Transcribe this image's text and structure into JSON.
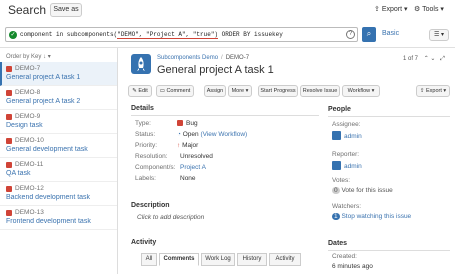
{
  "header": {
    "title": "Search",
    "save_as": "Save as",
    "export": "Export",
    "tools": "Tools"
  },
  "search": {
    "query_prefix": "component in subcomponents(",
    "query_args": "\"DEMO\", \"Project A\", \"true\")",
    "query_suffix": " ORDER BY issuekey",
    "search_icon": "search-icon",
    "basic_label": "Basic",
    "help_label": "?"
  },
  "sidebar": {
    "order_by": "Order by Key",
    "items": [
      {
        "key": "DEMO-7",
        "summary": "General project A task 1",
        "selected": true
      },
      {
        "key": "DEMO-8",
        "summary": "General project A task 2"
      },
      {
        "key": "DEMO-9",
        "summary": "Design task"
      },
      {
        "key": "DEMO-10",
        "summary": "General development task"
      },
      {
        "key": "DEMO-11",
        "summary": "QA task"
      },
      {
        "key": "DEMO-12",
        "summary": "Backend development task"
      },
      {
        "key": "DEMO-13",
        "summary": "Frontend development task"
      }
    ]
  },
  "issue": {
    "breadcrumb_project": "Subcomponents Demo",
    "breadcrumb_key": "DEMO-7",
    "title": "General project A task 1",
    "pager": "1 of 7",
    "ops": {
      "edit": "Edit",
      "comment": "Comment",
      "assign": "Assign",
      "more": "More",
      "start_progress": "Start Progress",
      "resolve": "Resolve Issue",
      "workflow": "Workflow",
      "export": "Export"
    },
    "details_label": "Details",
    "fields": {
      "type_label": "Type:",
      "type_value": "Bug",
      "status_label": "Status:",
      "status_value": "Open",
      "status_workflow": "(View Workflow)",
      "priority_label": "Priority:",
      "priority_value": "Major",
      "resolution_label": "Resolution:",
      "resolution_value": "Unresolved",
      "components_label": "Component/s:",
      "components_value": "Project A",
      "labels_label": "Labels:",
      "labels_value": "None"
    },
    "description_label": "Description",
    "description_placeholder": "Click to add description",
    "activity_label": "Activity",
    "tabs": [
      "All",
      "Comments",
      "Work Log",
      "History",
      "Activity"
    ],
    "active_tab": "Comments"
  },
  "people": {
    "title": "People",
    "assignee_label": "Assignee:",
    "assignee": "admin",
    "reporter_label": "Reporter:",
    "reporter": "admin",
    "votes_label": "Votes:",
    "votes_count": "0",
    "vote_link": "Vote for this issue",
    "watchers_label": "Watchers:",
    "watchers_count": "1",
    "watch_link": "Stop watching this issue"
  },
  "dates": {
    "title": "Dates",
    "created_label": "Created:",
    "created_value": "6 minutes ago"
  },
  "colors": {
    "accent": "#3572b0",
    "bug": "#d04437",
    "link": "#3b73af",
    "selected_bg": "#ebf2f9"
  }
}
